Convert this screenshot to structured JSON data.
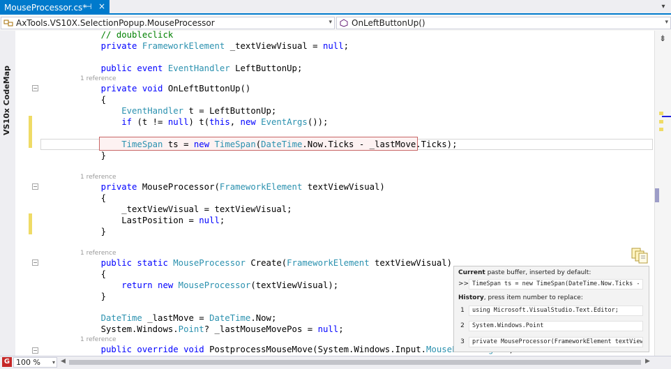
{
  "tab": {
    "title": "MouseProcessor.cs*",
    "pin": "⊣",
    "close": "×",
    "dropdown": "▾"
  },
  "nav": {
    "left_combo": "AxTools.VS10X.SelectionPopup.MouseProcessor",
    "right_combo": "OnLeftButtonUp()",
    "arrow": "▾"
  },
  "sidebar": {
    "label": "VS10x CodeMap"
  },
  "code": {
    "lines": [
      {
        "parts": [
          [
            "cm",
            "    // doubleclick"
          ]
        ]
      },
      {
        "parts": [
          [
            "kw",
            "    private "
          ],
          [
            "ty",
            "FrameworkElement"
          ],
          [
            "pl",
            " _textViewVisual = "
          ],
          [
            "kw",
            "null"
          ],
          [
            "pl",
            ";"
          ]
        ]
      },
      {
        "parts": [
          [
            "kw",
            "    public event "
          ],
          [
            "ty",
            "EventHandler"
          ],
          [
            "pl",
            " LeftButtonUp;"
          ]
        ]
      },
      {
        "parts": [
          [
            "kw",
            "    private void "
          ],
          [
            "pl",
            "OnLeftButtonUp()"
          ]
        ]
      },
      {
        "parts": [
          [
            "pl",
            "    {"
          ]
        ]
      },
      {
        "parts": [
          [
            "ty",
            "        EventHandler"
          ],
          [
            "pl",
            " t = LeftButtonUp;"
          ]
        ]
      },
      {
        "parts": [
          [
            "kw",
            "        if "
          ],
          [
            "pl",
            "(t != "
          ],
          [
            "kw",
            "null"
          ],
          [
            "pl",
            ") t("
          ],
          [
            "kw",
            "this"
          ],
          [
            "pl",
            ", "
          ],
          [
            "kw",
            "new "
          ],
          [
            "ty",
            "EventArgs"
          ],
          [
            "pl",
            "());"
          ]
        ]
      },
      {
        "parts": [
          [
            "ty",
            "        TimeSpan"
          ],
          [
            "pl",
            " ts = "
          ],
          [
            "kw",
            "new "
          ],
          [
            "ty",
            "TimeSpan"
          ],
          [
            "pl",
            "("
          ],
          [
            "ty",
            "DateTime"
          ],
          [
            "pl",
            ".Now.Ticks - _lastMove.Ticks);"
          ]
        ]
      },
      {
        "parts": [
          [
            "pl",
            "    }"
          ]
        ]
      },
      {
        "parts": [
          [
            "kw",
            "    private "
          ],
          [
            "pl",
            "MouseProcessor("
          ],
          [
            "ty",
            "FrameworkElement"
          ],
          [
            "pl",
            " textViewVisual)"
          ]
        ]
      },
      {
        "parts": [
          [
            "pl",
            "    {"
          ]
        ]
      },
      {
        "parts": [
          [
            "pl",
            "        _textViewVisual = textViewVisual;"
          ]
        ]
      },
      {
        "parts": [
          [
            "pl",
            "        LastPosition = "
          ],
          [
            "kw",
            "null"
          ],
          [
            "pl",
            ";"
          ]
        ]
      },
      {
        "parts": [
          [
            "pl",
            "    }"
          ]
        ]
      },
      {
        "parts": [
          [
            "kw",
            "    public static "
          ],
          [
            "ty",
            "MouseProcessor"
          ],
          [
            "pl",
            " Create("
          ],
          [
            "ty",
            "FrameworkElement"
          ],
          [
            "pl",
            " textViewVisual)"
          ]
        ]
      },
      {
        "parts": [
          [
            "pl",
            "    {"
          ]
        ]
      },
      {
        "parts": [
          [
            "kw",
            "        return new "
          ],
          [
            "ty",
            "MouseProcessor"
          ],
          [
            "pl",
            "(textViewVisual);"
          ]
        ]
      },
      {
        "parts": [
          [
            "pl",
            "    }"
          ]
        ]
      },
      {
        "parts": [
          [
            "ty",
            "    DateTime"
          ],
          [
            "pl",
            " _lastMove = "
          ],
          [
            "ty",
            "DateTime"
          ],
          [
            "pl",
            ".Now;"
          ]
        ]
      },
      {
        "parts": [
          [
            "pl",
            "    System.Windows."
          ],
          [
            "ty",
            "Point"
          ],
          [
            "pl",
            "? _lastMouseMovePos = "
          ],
          [
            "kw",
            "null"
          ],
          [
            "pl",
            ";"
          ]
        ]
      },
      {
        "parts": [
          [
            "kw",
            "    public override void "
          ],
          [
            "pl",
            "PostprocessMouseMove(System.Windows.Input."
          ],
          [
            "ty",
            "MouseEventArgs"
          ],
          [
            "pl",
            " e)"
          ]
        ]
      }
    ],
    "lens": [
      "1 reference",
      "1 reference",
      "1 reference",
      "1 reference"
    ]
  },
  "popup": {
    "current_bold": "Current",
    "current_rest": " paste buffer, inserted by default:",
    "current_marker": ">>",
    "current_value": "TimeSpan ts = new TimeSpan(DateTime.Now.Ticks - _l",
    "history_bold": "History",
    "history_rest": ", press item number to replace:",
    "items": [
      {
        "num": "1",
        "text": "using Microsoft.VisualStudio.Text.Editor;"
      },
      {
        "num": "2",
        "text": "System.Windows.Point"
      },
      {
        "num": "3",
        "text": "private MouseProcessor(FrameworkElement textViewVi"
      }
    ]
  },
  "status": {
    "zoom": "100 %",
    "gicon": "G"
  },
  "colors": {
    "accent": "#007acc",
    "keyword": "#0000ff",
    "type": "#2b91af",
    "comment": "#008000",
    "changed": "#efdb66"
  }
}
